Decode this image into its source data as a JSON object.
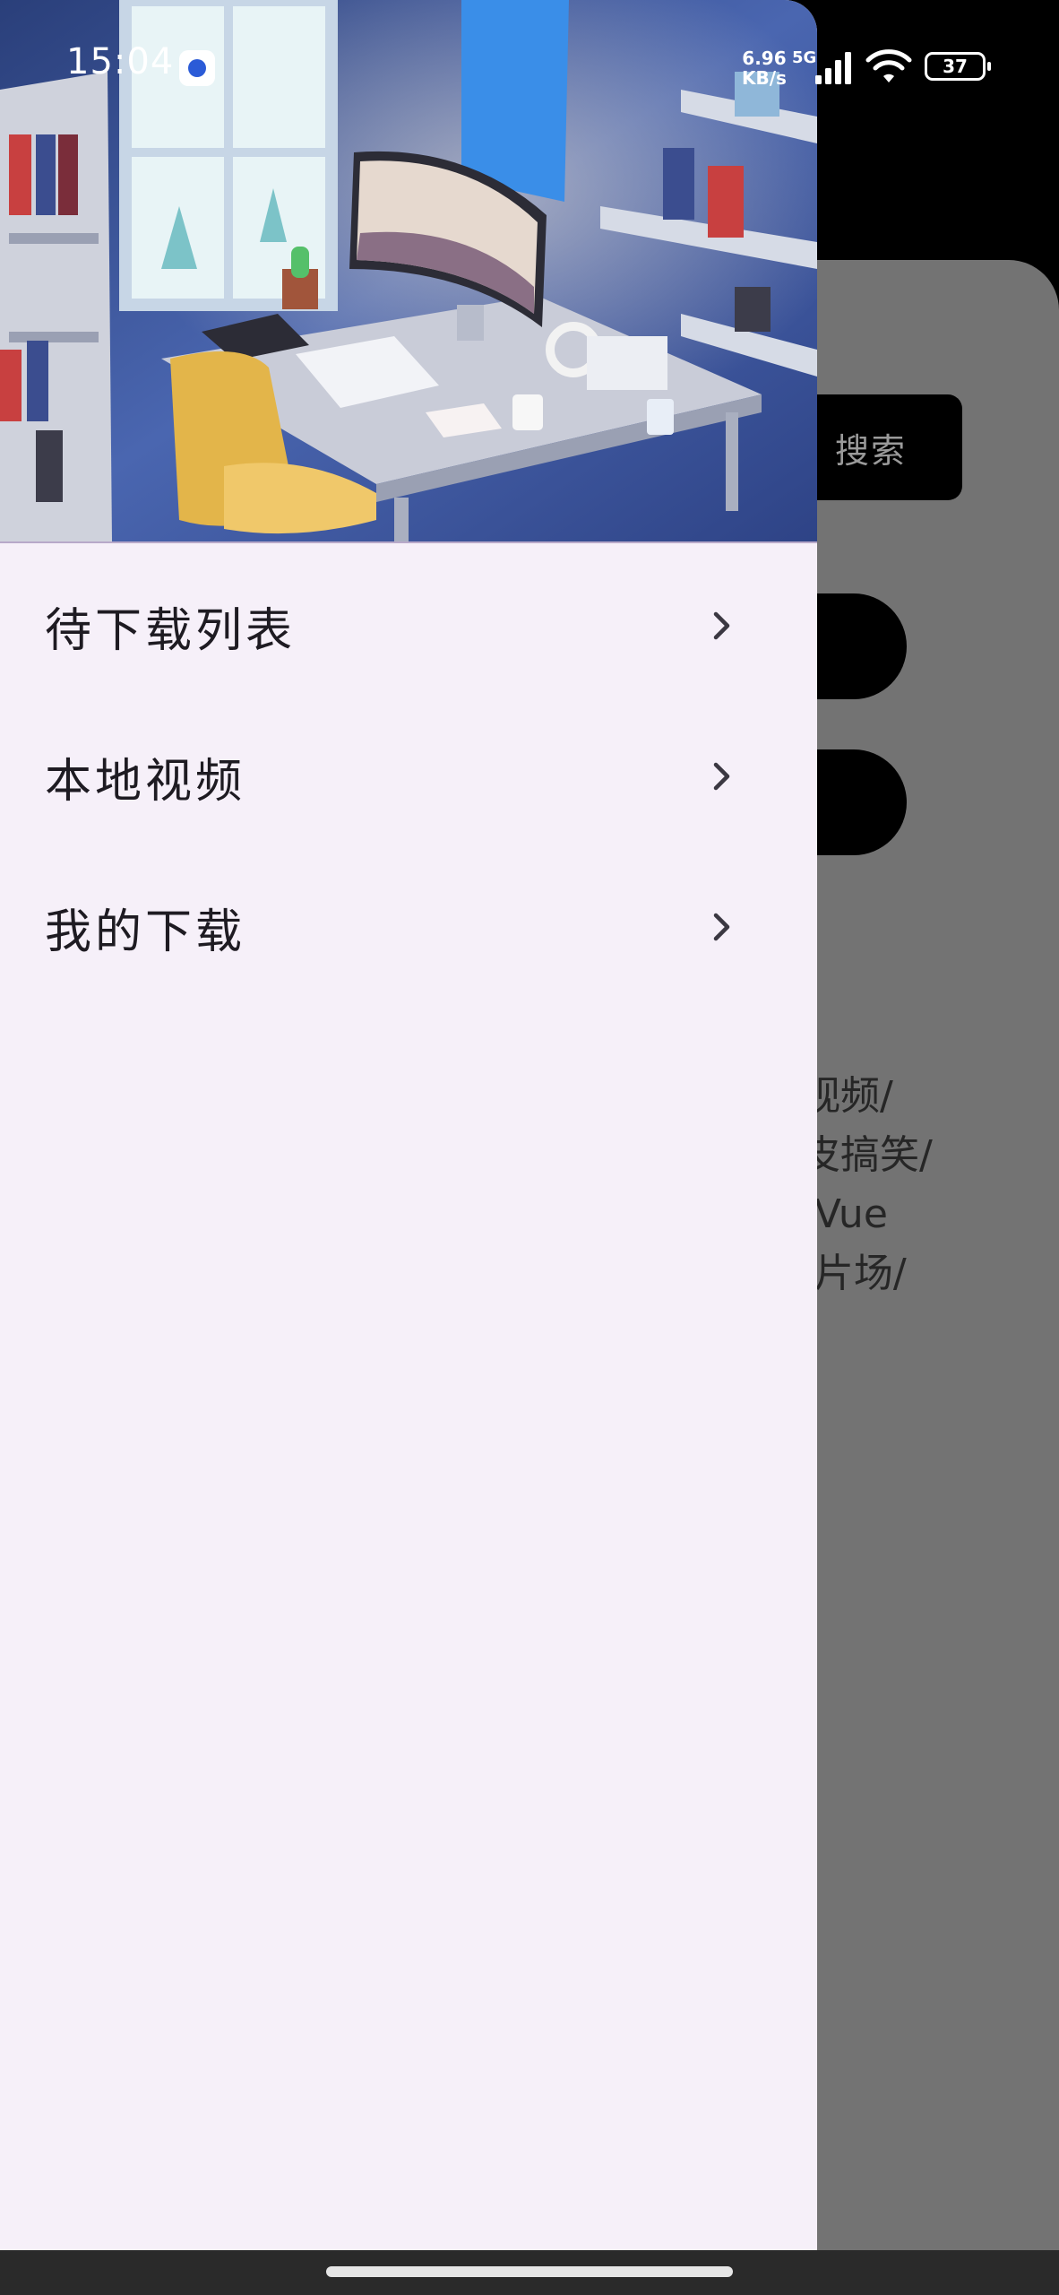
{
  "status_bar": {
    "time": "15:04",
    "net_speed_value": "6.96",
    "net_speed_unit": "KB/s",
    "network_type": "5G",
    "battery": "37"
  },
  "background_page": {
    "search_label": "搜索",
    "description": "轻视频/\n皮皮搞笑/\n根/Vue\n/新片场/"
  },
  "drawer": {
    "menu_items": [
      {
        "label": "待下载列表"
      },
      {
        "label": "本地视频"
      },
      {
        "label": "我的下载"
      }
    ]
  },
  "colors": {
    "drawer_bg": "#f6f0f9",
    "scrim": "#737373",
    "text": "#1e1b22"
  }
}
